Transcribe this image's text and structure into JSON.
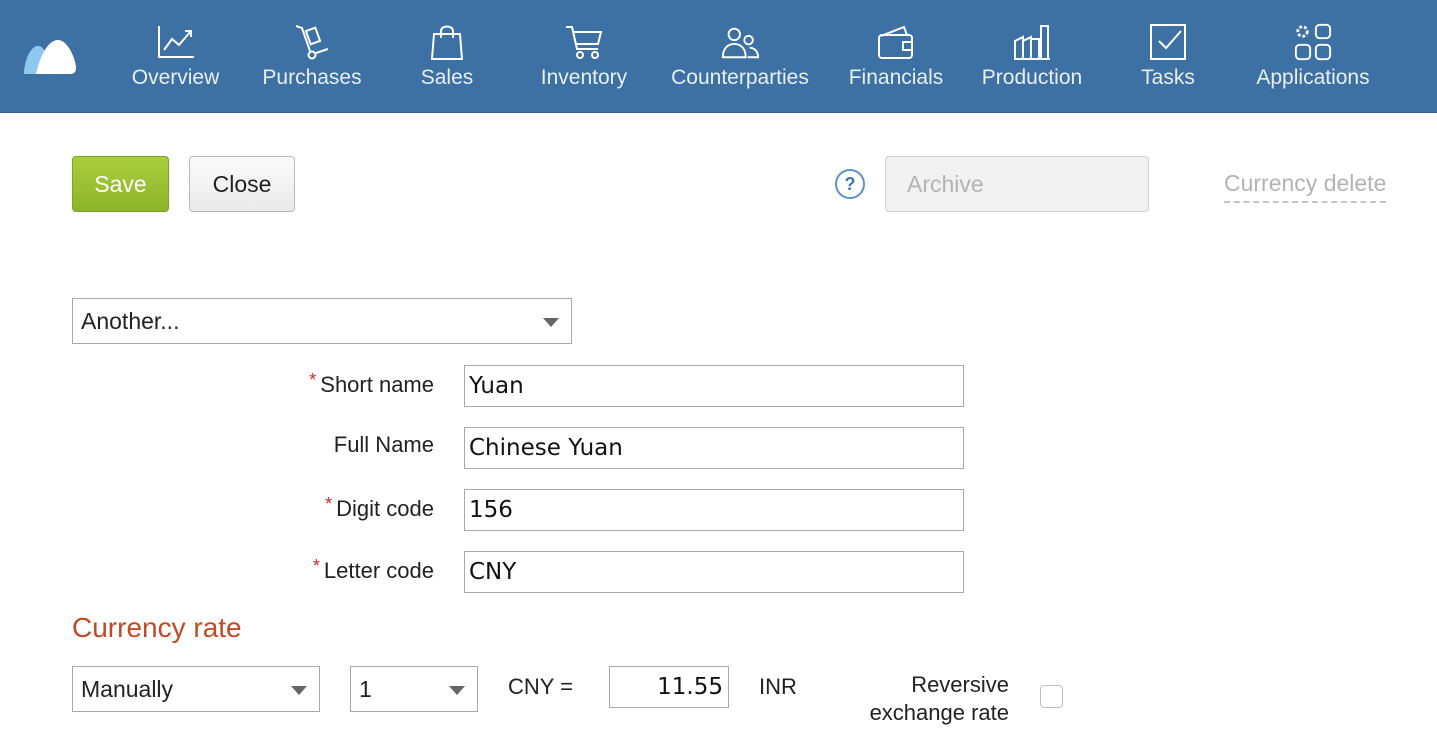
{
  "nav": {
    "items": [
      {
        "label": "Overview",
        "icon": "chart-line-icon"
      },
      {
        "label": "Purchases",
        "icon": "hand-truck-icon"
      },
      {
        "label": "Sales",
        "icon": "shopping-bag-icon"
      },
      {
        "label": "Inventory",
        "icon": "shopping-cart-icon"
      },
      {
        "label": "Counterparties",
        "icon": "people-icon"
      },
      {
        "label": "Financials",
        "icon": "wallet-icon"
      },
      {
        "label": "Production",
        "icon": "factory-icon"
      },
      {
        "label": "Tasks",
        "icon": "checkbox-icon"
      },
      {
        "label": "Applications",
        "icon": "apps-grid-icon"
      }
    ]
  },
  "toolbar": {
    "save_label": "Save",
    "close_label": "Close",
    "help_label": "?",
    "archive_label": "Archive",
    "delete_label": "Currency delete"
  },
  "currency_select": {
    "value": "Another..."
  },
  "form": {
    "short_name": {
      "label": "Short name",
      "value": "Yuan",
      "required": true
    },
    "full_name": {
      "label": "Full Name",
      "value": "Chinese Yuan",
      "required": false
    },
    "digit_code": {
      "label": "Digit code",
      "value": "156",
      "required": true
    },
    "letter_code": {
      "label": "Letter code",
      "value": "CNY",
      "required": true
    },
    "required_mark": "*"
  },
  "rate": {
    "section_title": "Currency rate",
    "mode": "Manually",
    "multiplier": "1",
    "from_text": "CNY =",
    "value": "11.55",
    "to_currency": "INR",
    "reversive_label_line1": "Reversive",
    "reversive_label_line2": "exchange rate",
    "reversive_checked": false
  },
  "colors": {
    "header_bg": "#3d70a3",
    "save_button": "#9bc234",
    "section_title": "#c04a26",
    "required_star": "#d2262c"
  }
}
